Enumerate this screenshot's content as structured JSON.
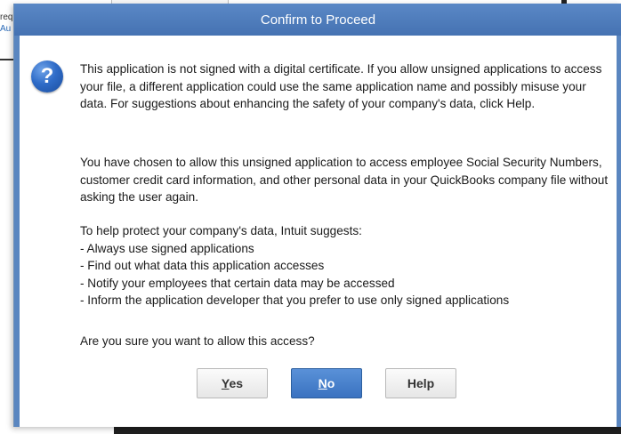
{
  "background": {
    "text_line1": "req",
    "text_line2": "Au"
  },
  "dialog": {
    "title": "Confirm to Proceed",
    "icon": "question-mark-icon",
    "paragraph1": "This application is not signed with a digital certificate.  If you allow unsigned applications to access your file, a different application could use the same application name and possibly misuse your data.  For suggestions about enhancing the safety of your company's data, click Help.",
    "paragraph2": "You have chosen to allow this unsigned application to access employee Social Security Numbers, customer credit card information, and other personal data in your QuickBooks company file without asking the user again.",
    "suggestions_heading": "To help protect your company's data, Intuit suggests:",
    "suggestions": [
      "- Always use signed applications",
      "- Find out what data this application accesses",
      "- Notify your employees that certain data may be accessed",
      "- Inform the application developer that you prefer to use only signed applications"
    ],
    "question": "Are you sure you want to allow this access?",
    "buttons": {
      "yes_mnemonic": "Y",
      "yes_rest": "es",
      "no_mnemonic": "N",
      "no_rest": "o",
      "help": "Help"
    }
  },
  "colors": {
    "titlebar": "#4f7fc0",
    "primary_button": "#3a72c0"
  }
}
